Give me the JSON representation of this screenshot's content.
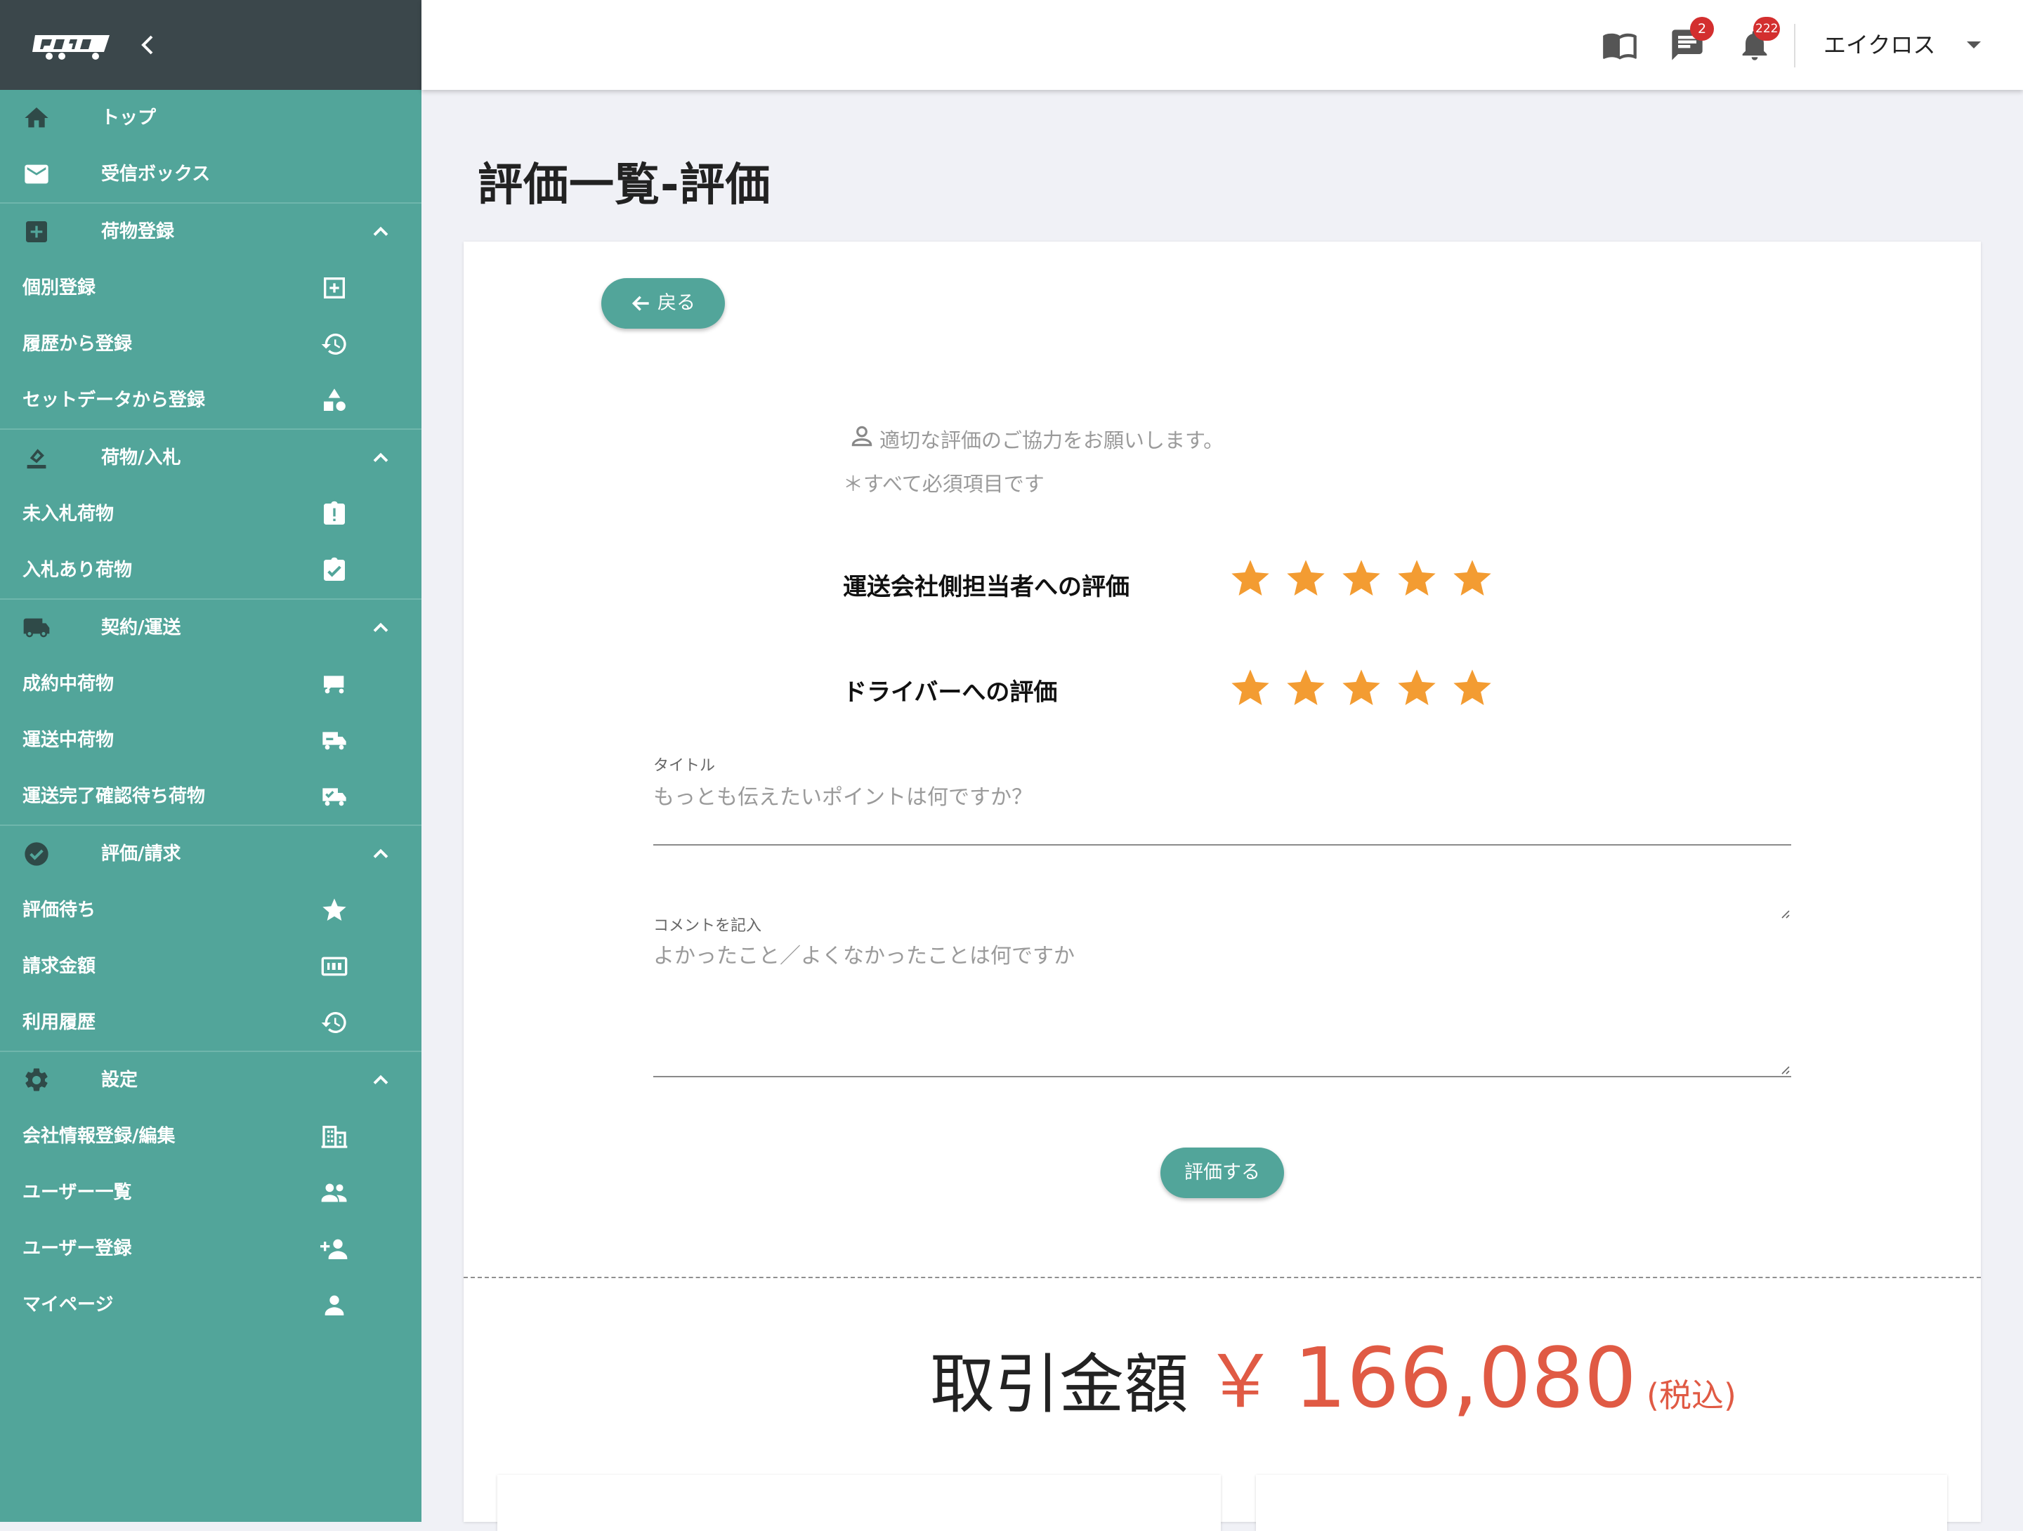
{
  "sidebar": {
    "items": [
      {
        "label": "トップ",
        "icon": "home-icon"
      },
      {
        "label": "受信ボックス",
        "icon": "mail-icon"
      },
      {
        "label": "荷物登録",
        "icon": "add-box-icon"
      },
      {
        "label": "個別登録",
        "icon": "add-square-icon"
      },
      {
        "label": "履歴から登録",
        "icon": "history-icon"
      },
      {
        "label": "セットデータから登録",
        "icon": "shapes-icon"
      },
      {
        "label": "荷物/入札",
        "icon": "bid-icon"
      },
      {
        "label": "未入札荷物",
        "icon": "clipboard-alert-icon"
      },
      {
        "label": "入札あり荷物",
        "icon": "clipboard-check-icon"
      },
      {
        "label": "契約/運送",
        "icon": "truck-icon"
      },
      {
        "label": "成約中荷物",
        "icon": "flatbed-truck-icon"
      },
      {
        "label": "運送中荷物",
        "icon": "truck-moving-icon"
      },
      {
        "label": "運送完了確認待ち荷物",
        "icon": "truck-check-icon"
      },
      {
        "label": "評価/請求",
        "icon": "check-circle-icon"
      },
      {
        "label": "評価待ち",
        "icon": "star-icon"
      },
      {
        "label": "請求金額",
        "icon": "counter-icon"
      },
      {
        "label": "利用履歴",
        "icon": "history-icon"
      },
      {
        "label": "設定",
        "icon": "gear-icon"
      },
      {
        "label": "会社情報登録/編集",
        "icon": "building-icon"
      },
      {
        "label": "ユーザー一覧",
        "icon": "people-icon"
      },
      {
        "label": "ユーザー登録",
        "icon": "person-add-icon"
      },
      {
        "label": "マイページ",
        "icon": "person-icon"
      }
    ]
  },
  "topbar": {
    "messages_badge": "2",
    "notifications_badge": "222",
    "user_name": "エイクロス"
  },
  "page": {
    "title": "評価一覧-評価",
    "back_label": "戻る",
    "hint_line1": "適切な評価のご協力をお願いします。",
    "hint_line2": "＊すべて必須項目です",
    "rating1_label": "運送会社側担当者への評価",
    "rating1_value": 5,
    "rating2_label": "ドライバーへの評価",
    "rating2_value": 5,
    "rating_max": 5,
    "title_field_label": "タイトル",
    "title_field_placeholder": "もっとも伝えたいポイントは何ですか？",
    "comment_field_label": "コメントを記入",
    "comment_field_placeholder": "よかったこと／よくなかったことは何ですか",
    "submit_label": "評価する",
    "amount_label": "取引金額",
    "currency": "￥",
    "amount_value": "166,080",
    "tax_label": "(税込)"
  },
  "colors": {
    "sidebar": "#52a59a",
    "sidebar_header": "#3b474b",
    "accent": "#52a59a",
    "star": "#f39c32",
    "amount": "#e05a44",
    "badge": "#d32f2f"
  }
}
